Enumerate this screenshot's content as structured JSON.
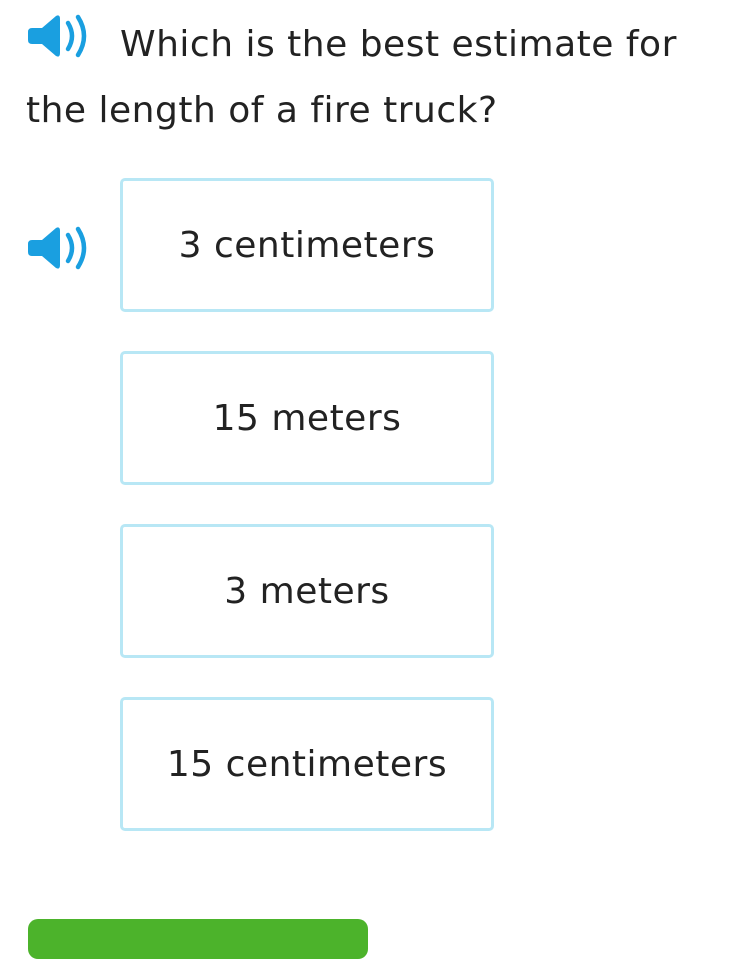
{
  "question": {
    "text": "Which is the best estimate for the length of a fire truck?",
    "speaker_icon": "speaker-icon"
  },
  "choices_speaker_icon": "speaker-icon",
  "choices": [
    {
      "label": "3 centimeters"
    },
    {
      "label": "15 meters"
    },
    {
      "label": "3 meters"
    },
    {
      "label": "15 centimeters"
    }
  ],
  "colors": {
    "accent_blue": "#1a9fe0",
    "choice_border": "#b8e7f5",
    "submit_green": "#4cb32b",
    "text": "#222222"
  }
}
